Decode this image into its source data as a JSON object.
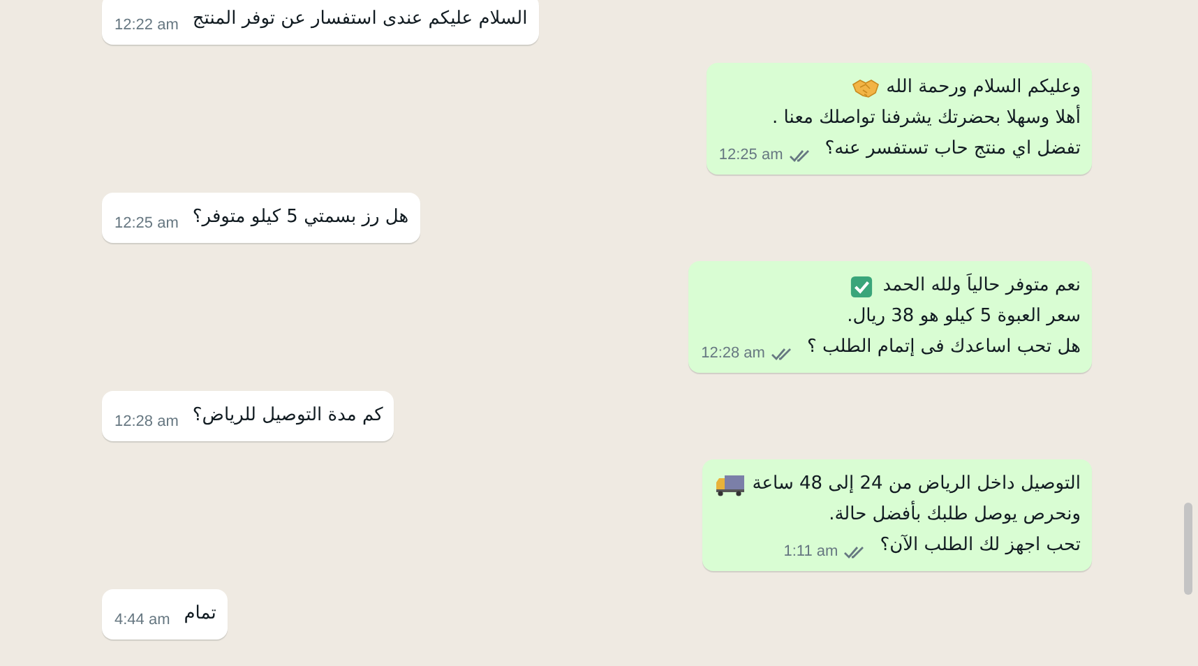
{
  "messages": [
    {
      "kind": "received",
      "lines": [
        {
          "text": "السلام عليكم عندى استفسار عن توفر المنتج"
        }
      ],
      "time": "12:22 am"
    },
    {
      "kind": "sent",
      "lines": [
        {
          "text": "وعليكم السلام ورحمة الله",
          "kind": "emoji"
        },
        {
          "text": "أهلا وسهلا بحضرتك يشرفنا تواصلك معنا ."
        },
        {
          "text": "تفضل اي منتج حاب تستفسر عنه؟"
        }
      ],
      "time": "12:25 am",
      "read": false
    },
    {
      "kind": "received",
      "lines": [
        {
          "text": "هل رز بسمتي 5 كيلو متوفر؟"
        }
      ],
      "time": "12:25 am"
    },
    {
      "kind": "sent",
      "lines": [
        {
          "text": "نعم متوفر حالياَ ولله الحمد",
          "kind": "emoji"
        },
        {
          "text": "سعر العبوة 5 كيلو هو 38 ريال."
        },
        {
          "text": "هل تحب اساعدك فى إتمام الطلب ؟"
        }
      ],
      "time": "12:28 am",
      "read": false
    },
    {
      "kind": "received",
      "lines": [
        {
          "text": "كم مدة التوصيل للرياض؟"
        }
      ],
      "time": "12:28 am"
    },
    {
      "kind": "sent",
      "lines": [
        {
          "text": "التوصيل داخل الرياض من 24 إلى 48 ساعة",
          "kind": "emoji"
        },
        {
          "text": "ونحرص يوصل طلبك بأفضل حالة."
        },
        {
          "text": "تحب اجهز لك الطلب الآن؟"
        }
      ],
      "time": "1:11 am",
      "read": false
    },
    {
      "kind": "received",
      "lines": [
        {
          "text": "تمام"
        }
      ],
      "time": "4:44 am"
    }
  ]
}
